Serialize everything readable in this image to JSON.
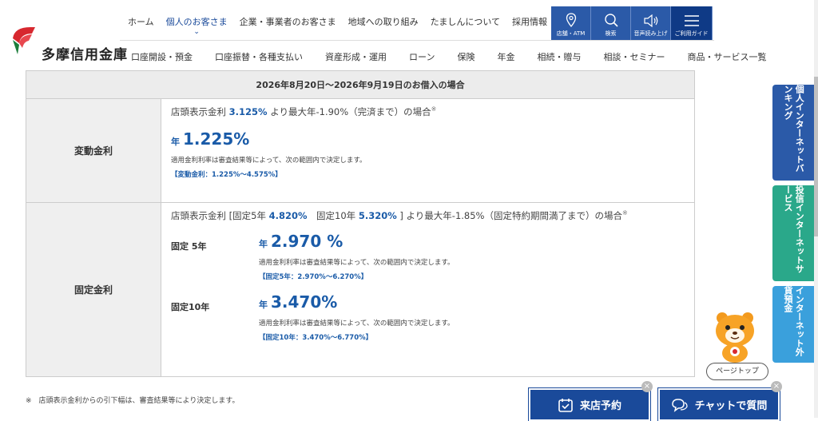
{
  "header": {
    "logo_text": "多摩信用金庫",
    "topnav": [
      "ホーム",
      "個人のお客さま",
      "企業・事業者のお客さま",
      "地域への取り組み",
      "たましんについて",
      "採用情報"
    ],
    "tools": [
      "店舗・ATM",
      "検索",
      "音声読み上げ",
      "ご利用ガイド"
    ],
    "subnav": [
      "口座開設・預金",
      "口座振替・各種支払い",
      "資産形成・運用",
      "ローン",
      "保険",
      "年金",
      "相続・贈与",
      "相談・セミナー",
      "商品・サービス一覧"
    ]
  },
  "table": {
    "heading": "2026年8月20日～2026年9月19日のお借入の場合",
    "variable": {
      "label": "変動金利",
      "cond_pre": "店頭表示金利 ",
      "cond_rate": "3.125%",
      "cond_post": " より最大年-1.90%（完済まで）の場合",
      "mark": "※",
      "prefix": "年",
      "rate": "1.225%",
      "note": "適用金利利率は審査結果等によって、次の範囲内で決定します。",
      "range": "【変動金利：1.225%～4.575%】"
    },
    "fixed": {
      "label": "固定金利",
      "cond_pre": "店頭表示金利 [固定5年 ",
      "cond_rate5": "4.820%",
      "cond_mid": "　固定10年 ",
      "cond_rate10": "5.320%",
      "cond_post": " ] より最大年-1.85%（固定特約期間満了まで）の場合",
      "mark": "※",
      "items": [
        {
          "label": "固定 5年",
          "prefix": "年",
          "rate": "2.970 %",
          "note": "適用金利利率は審査結果等によって、次の範囲内で決定します。",
          "range": "【固定5年：2.970%～6.270%】"
        },
        {
          "label": "固定10年",
          "prefix": "年",
          "rate": "3.470%",
          "note": "適用金利利率は審査結果等によって、次の範囲内で決定します。",
          "range": "【固定10年：3.470%～6.770%】"
        }
      ]
    }
  },
  "footnote": "※　店頭表示金利からの引下幅は、審査結果等により決定します。",
  "side_tabs": [
    "個人インターネットバンキング",
    "投信インターネットサービス",
    "インターネット外貨預金"
  ],
  "page_top": "ページトップ",
  "floating": {
    "reserve": "来店予約",
    "chat": "チャットで質問",
    "close": "×"
  },
  "colors": {
    "primary": "#1a4a9a",
    "rate_blue": "#1a5ba8",
    "brand_red": "#d7282f",
    "green_tab": "#2aa88a",
    "lightblue_tab": "#3aa0dc"
  }
}
